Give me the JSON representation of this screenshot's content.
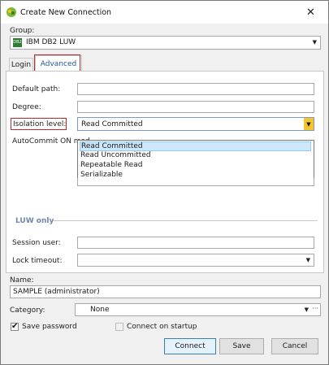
{
  "window": {
    "title": "Create New Connection",
    "close": "✕"
  },
  "group": {
    "label": "Group:",
    "value": "IBM DB2 LUW",
    "icon_text": "DB2"
  },
  "tabs": [
    {
      "label": "Login"
    },
    {
      "label": "Advanced"
    }
  ],
  "advanced": {
    "default_path_label": "Default path:",
    "default_path_value": "",
    "degree_label": "Degree:",
    "degree_value": "",
    "isolation_label": "Isolation level:",
    "isolation_value": "Read Committed",
    "isolation_options": [
      "Read Committed",
      "Read Uncommitted",
      "Repeatable Read",
      "Serializable"
    ],
    "autocommit_label": "AutoCommit ON mod",
    "luw_only_label": "LUW only",
    "session_user_label": "Session user:",
    "session_user_value": "",
    "lock_timeout_label": "Lock timeout:",
    "lock_timeout_value": ""
  },
  "name": {
    "label": "Name:",
    "value": "SAMPLE (administrator)"
  },
  "category": {
    "label": "Category:",
    "value": "None",
    "ellipsis": "···"
  },
  "save_password": {
    "label": "Save password",
    "checked": true,
    "check_glyph": "✔"
  },
  "connect_on_startup": {
    "label": "Connect on startup",
    "checked": false
  },
  "buttons": {
    "connect": "Connect",
    "save": "Save",
    "cancel": "Cancel"
  },
  "colors": {
    "highlight": "#c0272d",
    "selection": "#cce8ff",
    "tab_active_text": "#1e5aa8"
  }
}
